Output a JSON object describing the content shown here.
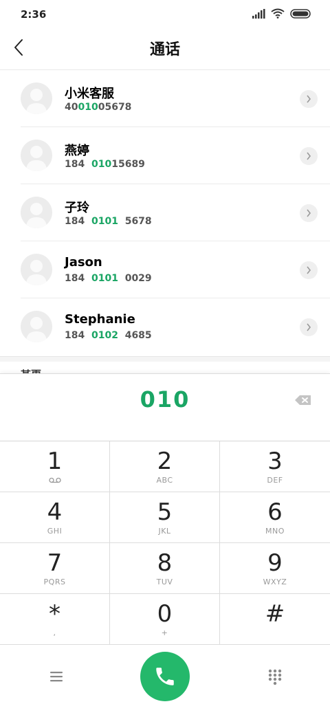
{
  "status_bar": {
    "time": "2:36"
  },
  "header": {
    "title": "通话"
  },
  "contacts": [
    {
      "name": "小米客服",
      "number_pre": "40",
      "number_match": "010",
      "number_post": "05678"
    },
    {
      "name": "燕婷",
      "number_pre": "184  ",
      "number_match": "010",
      "number_post": "15689"
    },
    {
      "name": "子玲",
      "number_pre": "184  ",
      "number_match": "0101",
      "number_post": "  5678"
    },
    {
      "name": "Jason",
      "number_pre": "184  ",
      "number_match": "0101",
      "number_post": "  0029"
    },
    {
      "name": "Stephanie",
      "number_pre": "184  ",
      "number_match": "0102",
      "number_post": "  4685"
    }
  ],
  "section_peek": "某更",
  "dial_input": {
    "value": "010"
  },
  "keypad": [
    {
      "digit": "1",
      "letters": ""
    },
    {
      "digit": "2",
      "letters": "ABC"
    },
    {
      "digit": "3",
      "letters": "DEF"
    },
    {
      "digit": "4",
      "letters": "GHI"
    },
    {
      "digit": "5",
      "letters": "JKL"
    },
    {
      "digit": "6",
      "letters": "MNO"
    },
    {
      "digit": "7",
      "letters": "PQRS"
    },
    {
      "digit": "8",
      "letters": "TUV"
    },
    {
      "digit": "9",
      "letters": "WXYZ"
    },
    {
      "digit": "*",
      "letters": ","
    },
    {
      "digit": "0",
      "letters": "+"
    },
    {
      "digit": "#",
      "letters": ""
    }
  ],
  "colors": {
    "accent": "#1aa564",
    "call_button": "#24b86b"
  },
  "icons": [
    "back-arrow-icon",
    "signal-icon",
    "wifi-icon",
    "battery-icon",
    "avatar-placeholder-icon",
    "chevron-right-icon",
    "backspace-icon",
    "voicemail-icon",
    "menu-icon",
    "phone-icon",
    "dialpad-icon"
  ]
}
